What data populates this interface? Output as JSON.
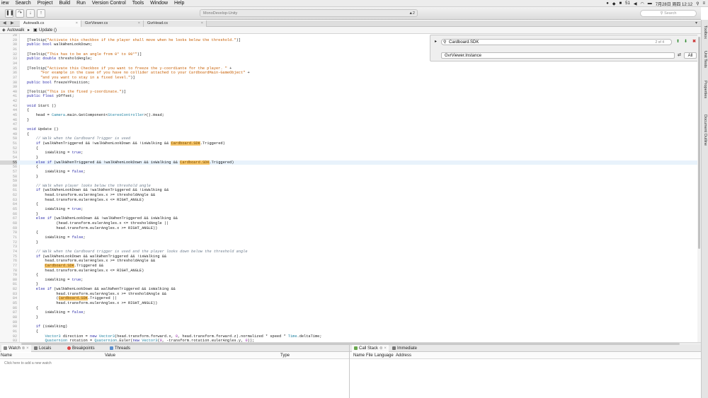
{
  "menubar": {
    "items": [
      "iew",
      "Search",
      "Project",
      "Build",
      "Run",
      "Version Control",
      "Tools",
      "Window",
      "Help"
    ],
    "status_numbers": "51",
    "datetime": "7月28日 周四 12:12"
  },
  "toolbar": {
    "status_text": "MonoDevelop-Unity",
    "warnings": "▲2",
    "search_placeholder": "Search"
  },
  "tabs": [
    {
      "label": "Autowalk.cs",
      "active": true
    },
    {
      "label": "GvrViewer.cs",
      "active": false
    },
    {
      "label": "GvrHead.cs",
      "active": false
    }
  ],
  "breadcrumb": {
    "class": "Autowalk",
    "member": "Update ()"
  },
  "find": {
    "query": "Cardboard.SDK",
    "count": "2 of 4",
    "replace": "GvrViewer.Instance",
    "all_label": "All"
  },
  "side_tabs": [
    "Toolbox",
    "Unit Tests",
    "Properties",
    "Document Outline"
  ],
  "highlight_token": "Cardboard.SDK",
  "current_line": 55,
  "code_lines": [
    {
      "n": "28",
      "t": ""
    },
    {
      "n": "29",
      "t": "[Tooltip(\"Activate this checkbox if the player shall move when he looks below the threshold.\")]"
    },
    {
      "n": "30",
      "t": "public bool walkWhenLookDown;"
    },
    {
      "n": "31",
      "t": ""
    },
    {
      "n": "32",
      "t": "[Tooltip(\"This has to be an angle from 0° to 90°\")]"
    },
    {
      "n": "33",
      "t": "public double thresholdAngle;"
    },
    {
      "n": "34",
      "t": ""
    },
    {
      "n": "35",
      "t": "[Tooltip(\"Activate this Checkbox if you want to freeze the y-coordiante for the player. \" +"
    },
    {
      "n": "36",
      "t": "      \"For example in the case of you have no collider attached to your CardboardMain-GameObject\" +"
    },
    {
      "n": "37",
      "t": "      \"and you want to stay in a fixed level.\")]"
    },
    {
      "n": "38",
      "t": "public bool freezeYPosition;"
    },
    {
      "n": "39",
      "t": ""
    },
    {
      "n": "40",
      "t": "[Tooltip(\"This is the fixed y-coordinate.\")]"
    },
    {
      "n": "41",
      "t": "public float yOffset;"
    },
    {
      "n": "42",
      "t": ""
    },
    {
      "n": "43",
      "t": "void Start ()"
    },
    {
      "n": "44",
      "t": "{"
    },
    {
      "n": "45",
      "t": "    head = Camera.main.GetComponent<StereoController>().Head;"
    },
    {
      "n": "46",
      "t": "}"
    },
    {
      "n": "47",
      "t": ""
    },
    {
      "n": "48",
      "t": "void Update ()"
    },
    {
      "n": "49",
      "t": "{"
    },
    {
      "n": "50",
      "t": "    // Walk when the Cardboard Trigger is used"
    },
    {
      "n": "51",
      "t": "    if (walkWhenTriggered && !walkWhenLookDown && !isWalking && Cardboard.SDK.Triggered)"
    },
    {
      "n": "52",
      "t": "    {"
    },
    {
      "n": "53",
      "t": "        isWalking = true;"
    },
    {
      "n": "54",
      "t": "    }"
    },
    {
      "n": "55",
      "t": "    else if (walkWhenTriggered && !walkWhenLookDown && isWalking && Cardboard.SDK.Triggered)"
    },
    {
      "n": "56",
      "t": "    {"
    },
    {
      "n": "57",
      "t": "        isWalking = false;"
    },
    {
      "n": "58",
      "t": "    }"
    },
    {
      "n": "59",
      "t": ""
    },
    {
      "n": "60",
      "t": "    // Walk when player looks below the threshold angle"
    },
    {
      "n": "61",
      "t": "    if (walkWhenLookDown && !walkWhenTriggered && !isWalking &&"
    },
    {
      "n": "62",
      "t": "        head.transform.eulerAngles.x >= thresholdAngle &&"
    },
    {
      "n": "63",
      "t": "        head.transform.eulerAngles.x <= RIGHT_ANGLE)"
    },
    {
      "n": "64",
      "t": "    {"
    },
    {
      "n": "65",
      "t": "        isWalking = true;"
    },
    {
      "n": "66",
      "t": "    }"
    },
    {
      "n": "67",
      "t": "    else if (walkWhenLookDown && !walkWhenTriggered && isWalking &&"
    },
    {
      "n": "68",
      "t": "             (head.transform.eulerAngles.x <= thresholdAngle ||"
    },
    {
      "n": "69",
      "t": "             head.transform.eulerAngles.x >= RIGHT_ANGLE))"
    },
    {
      "n": "70",
      "t": "    {"
    },
    {
      "n": "71",
      "t": "        isWalking = false;"
    },
    {
      "n": "72",
      "t": "    }"
    },
    {
      "n": "73",
      "t": ""
    },
    {
      "n": "74",
      "t": "    // Walk when the Cardboard trigger is used and the player looks down below the threshold angle"
    },
    {
      "n": "75",
      "t": "    if (walkWhenLookDown && walkWhenTriggered && !isWalking &&"
    },
    {
      "n": "76",
      "t": "        head.transform.eulerAngles.x >= thresholdAngle &&"
    },
    {
      "n": "77",
      "t": "        Cardboard.SDK.Triggered &&"
    },
    {
      "n": "78",
      "t": "        head.transform.eulerAngles.x <= RIGHT_ANGLE)"
    },
    {
      "n": "79",
      "t": "    {"
    },
    {
      "n": "80",
      "t": "        isWalking = true;"
    },
    {
      "n": "81",
      "t": "    }"
    },
    {
      "n": "82",
      "t": "    else if (walkWhenLookDown && walkWhenTriggered && isWalking &&"
    },
    {
      "n": "83",
      "t": "             head.transform.eulerAngles.x >= thresholdAngle &&"
    },
    {
      "n": "84",
      "t": "             (Cardboard.SDK.Triggered ||"
    },
    {
      "n": "85",
      "t": "             head.transform.eulerAngles.x >= RIGHT_ANGLE))"
    },
    {
      "n": "86",
      "t": "    {"
    },
    {
      "n": "87",
      "t": "        isWalking = false;"
    },
    {
      "n": "88",
      "t": "    }"
    },
    {
      "n": "89",
      "t": ""
    },
    {
      "n": "90",
      "t": "    if (isWalking)"
    },
    {
      "n": "91",
      "t": "    {"
    },
    {
      "n": "92",
      "t": "        Vector3 direction = new Vector3(head.transform.forward.x, 0, head.transform.forward.z).normalized * speed * Time.deltaTime;"
    },
    {
      "n": "93",
      "t": "        Quaternion rotation = Quaternion.Euler(new Vector3(0, -transform.rotation.eulerAngles.y, 0));"
    }
  ],
  "left_pad": {
    "tabs": [
      "Watch",
      "Locals",
      "Breakpoints",
      "Threads"
    ],
    "columns": [
      "Name",
      "Value",
      "Type"
    ],
    "empty_text": "Click here to add a new watch"
  },
  "right_pad": {
    "tabs": [
      "Call Stack",
      "Immediate"
    ],
    "columns": [
      "Name",
      "File",
      "Language",
      "Address"
    ]
  },
  "colors": {
    "highlight": "#f8c76b",
    "keyword": "#2a2aa8",
    "string": "#c65d00",
    "comment": "#6e7d8e"
  }
}
